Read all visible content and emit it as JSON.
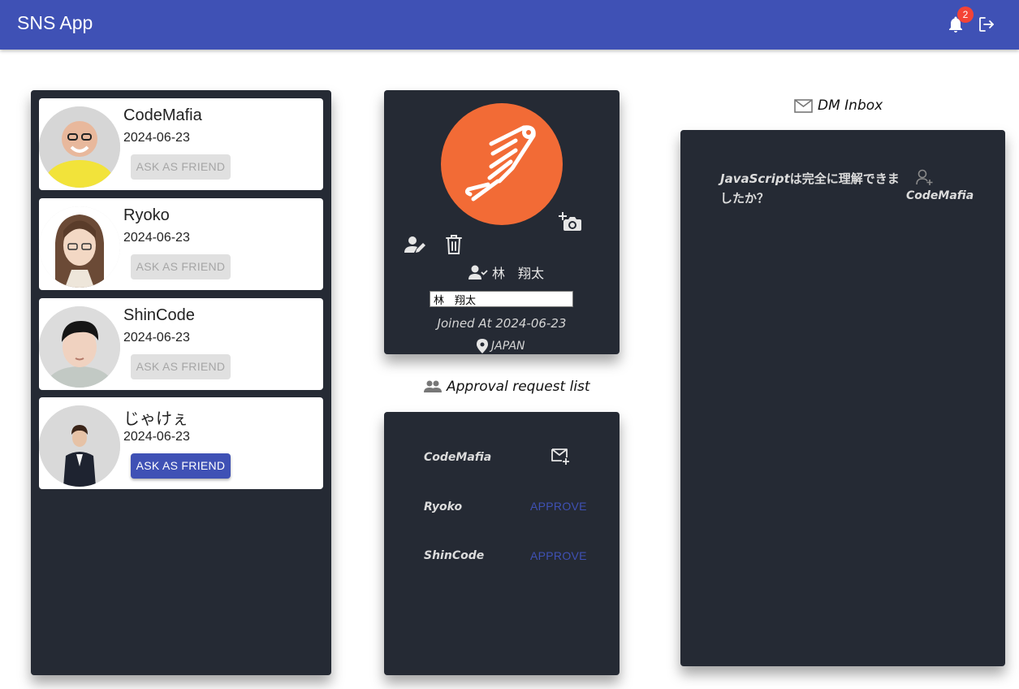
{
  "app": {
    "title": "SNS App",
    "notification_count": "2",
    "accent_color": "#3f51b5",
    "panel_color": "#252a34"
  },
  "users": [
    {
      "name": "CodeMafia",
      "date": "2024-06-23",
      "button": "ASK AS FRIEND",
      "button_state": "disabled"
    },
    {
      "name": "Ryoko",
      "date": "2024-06-23",
      "button": "ASK AS FRIEND",
      "button_state": "disabled"
    },
    {
      "name": "ShinCode",
      "date": "2024-06-23",
      "button": "ASK AS FRIEND",
      "button_state": "disabled"
    },
    {
      "name": "じゃけぇ",
      "date": "2024-06-23",
      "button": "ASK AS FRIEND",
      "button_state": "active"
    }
  ],
  "profile": {
    "display_name": "林　翔太",
    "name_input_value": "林　翔太",
    "joined": "Joined At 2024-06-23",
    "country": "JAPAN",
    "avatar_color": "#f26b36"
  },
  "approval": {
    "heading": "Approval request list",
    "requests": [
      {
        "name": "CodeMafia",
        "action": "dm"
      },
      {
        "name": "Ryoko",
        "action": "APPROVE"
      },
      {
        "name": "ShinCode",
        "action": "APPROVE"
      }
    ]
  },
  "dm": {
    "heading": "DM Inbox",
    "message_prefix": "JavaScript",
    "message_rest": "は完全に理解できましたか？",
    "sender": "CodeMafia"
  }
}
